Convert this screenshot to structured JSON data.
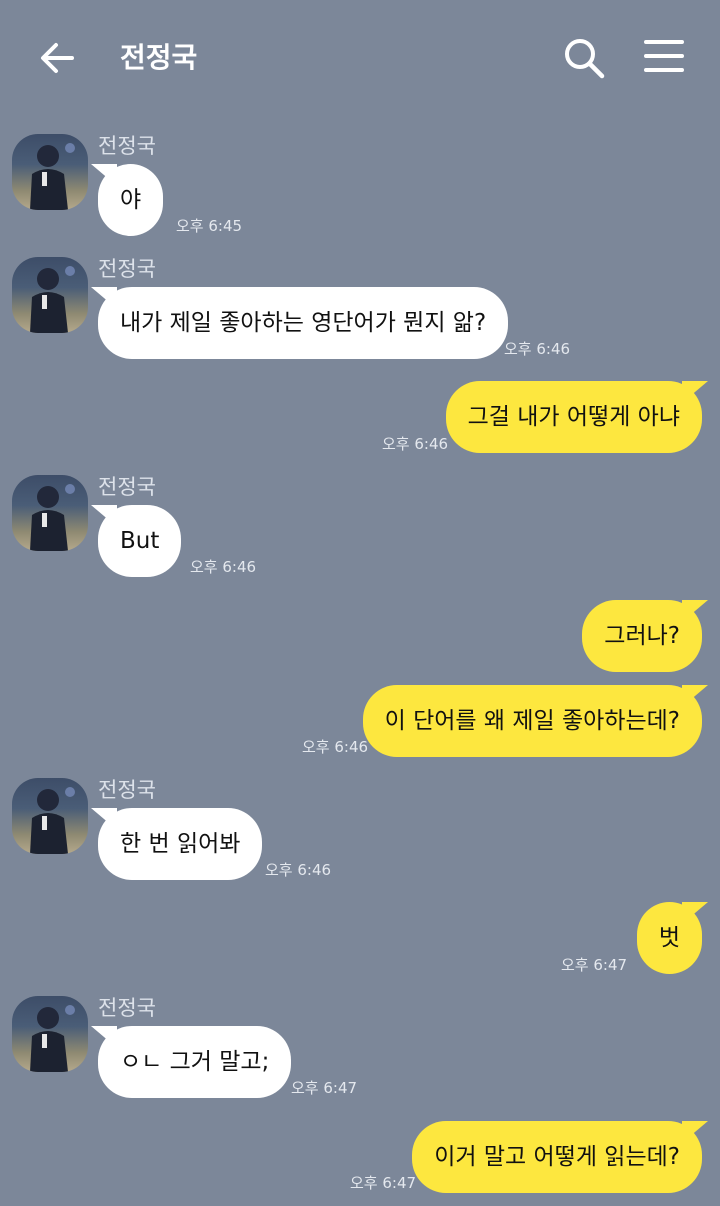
{
  "header": {
    "title": "전정국",
    "back_icon": "back-arrow-icon",
    "search_icon": "search-icon",
    "menu_icon": "hamburger-menu-icon"
  },
  "colors": {
    "background": "#7c8799",
    "incoming_bubble": "#ffffff",
    "outgoing_bubble": "#fde73f"
  },
  "messages": [
    {
      "from": "전정국",
      "direction": "in",
      "text": "야",
      "time": "오후 6:45"
    },
    {
      "from": "전정국",
      "direction": "in",
      "text": "내가 제일 좋아하는 영단어가 뭔지 앎?",
      "time": "오후 6:46"
    },
    {
      "direction": "out",
      "text": "그걸 내가 어떻게 아냐",
      "time": "오후 6:46"
    },
    {
      "from": "전정국",
      "direction": "in",
      "text": "But",
      "time": "오후 6:46"
    },
    {
      "direction": "out",
      "text": "그러나?",
      "time": ""
    },
    {
      "direction": "out",
      "text": "이 단어를 왜 제일 좋아하는데?",
      "time": "오후 6:46"
    },
    {
      "from": "전정국",
      "direction": "in",
      "text": "한 번 읽어봐",
      "time": "오후 6:46"
    },
    {
      "direction": "out",
      "text": "벗",
      "time": "오후 6:47"
    },
    {
      "from": "전정국",
      "direction": "in",
      "text": "ㅇㄴ 그거 말고;",
      "time": "오후 6:47"
    },
    {
      "direction": "out",
      "text": "이거 말고 어떻게 읽는데?",
      "time": "오후 6:47"
    }
  ]
}
